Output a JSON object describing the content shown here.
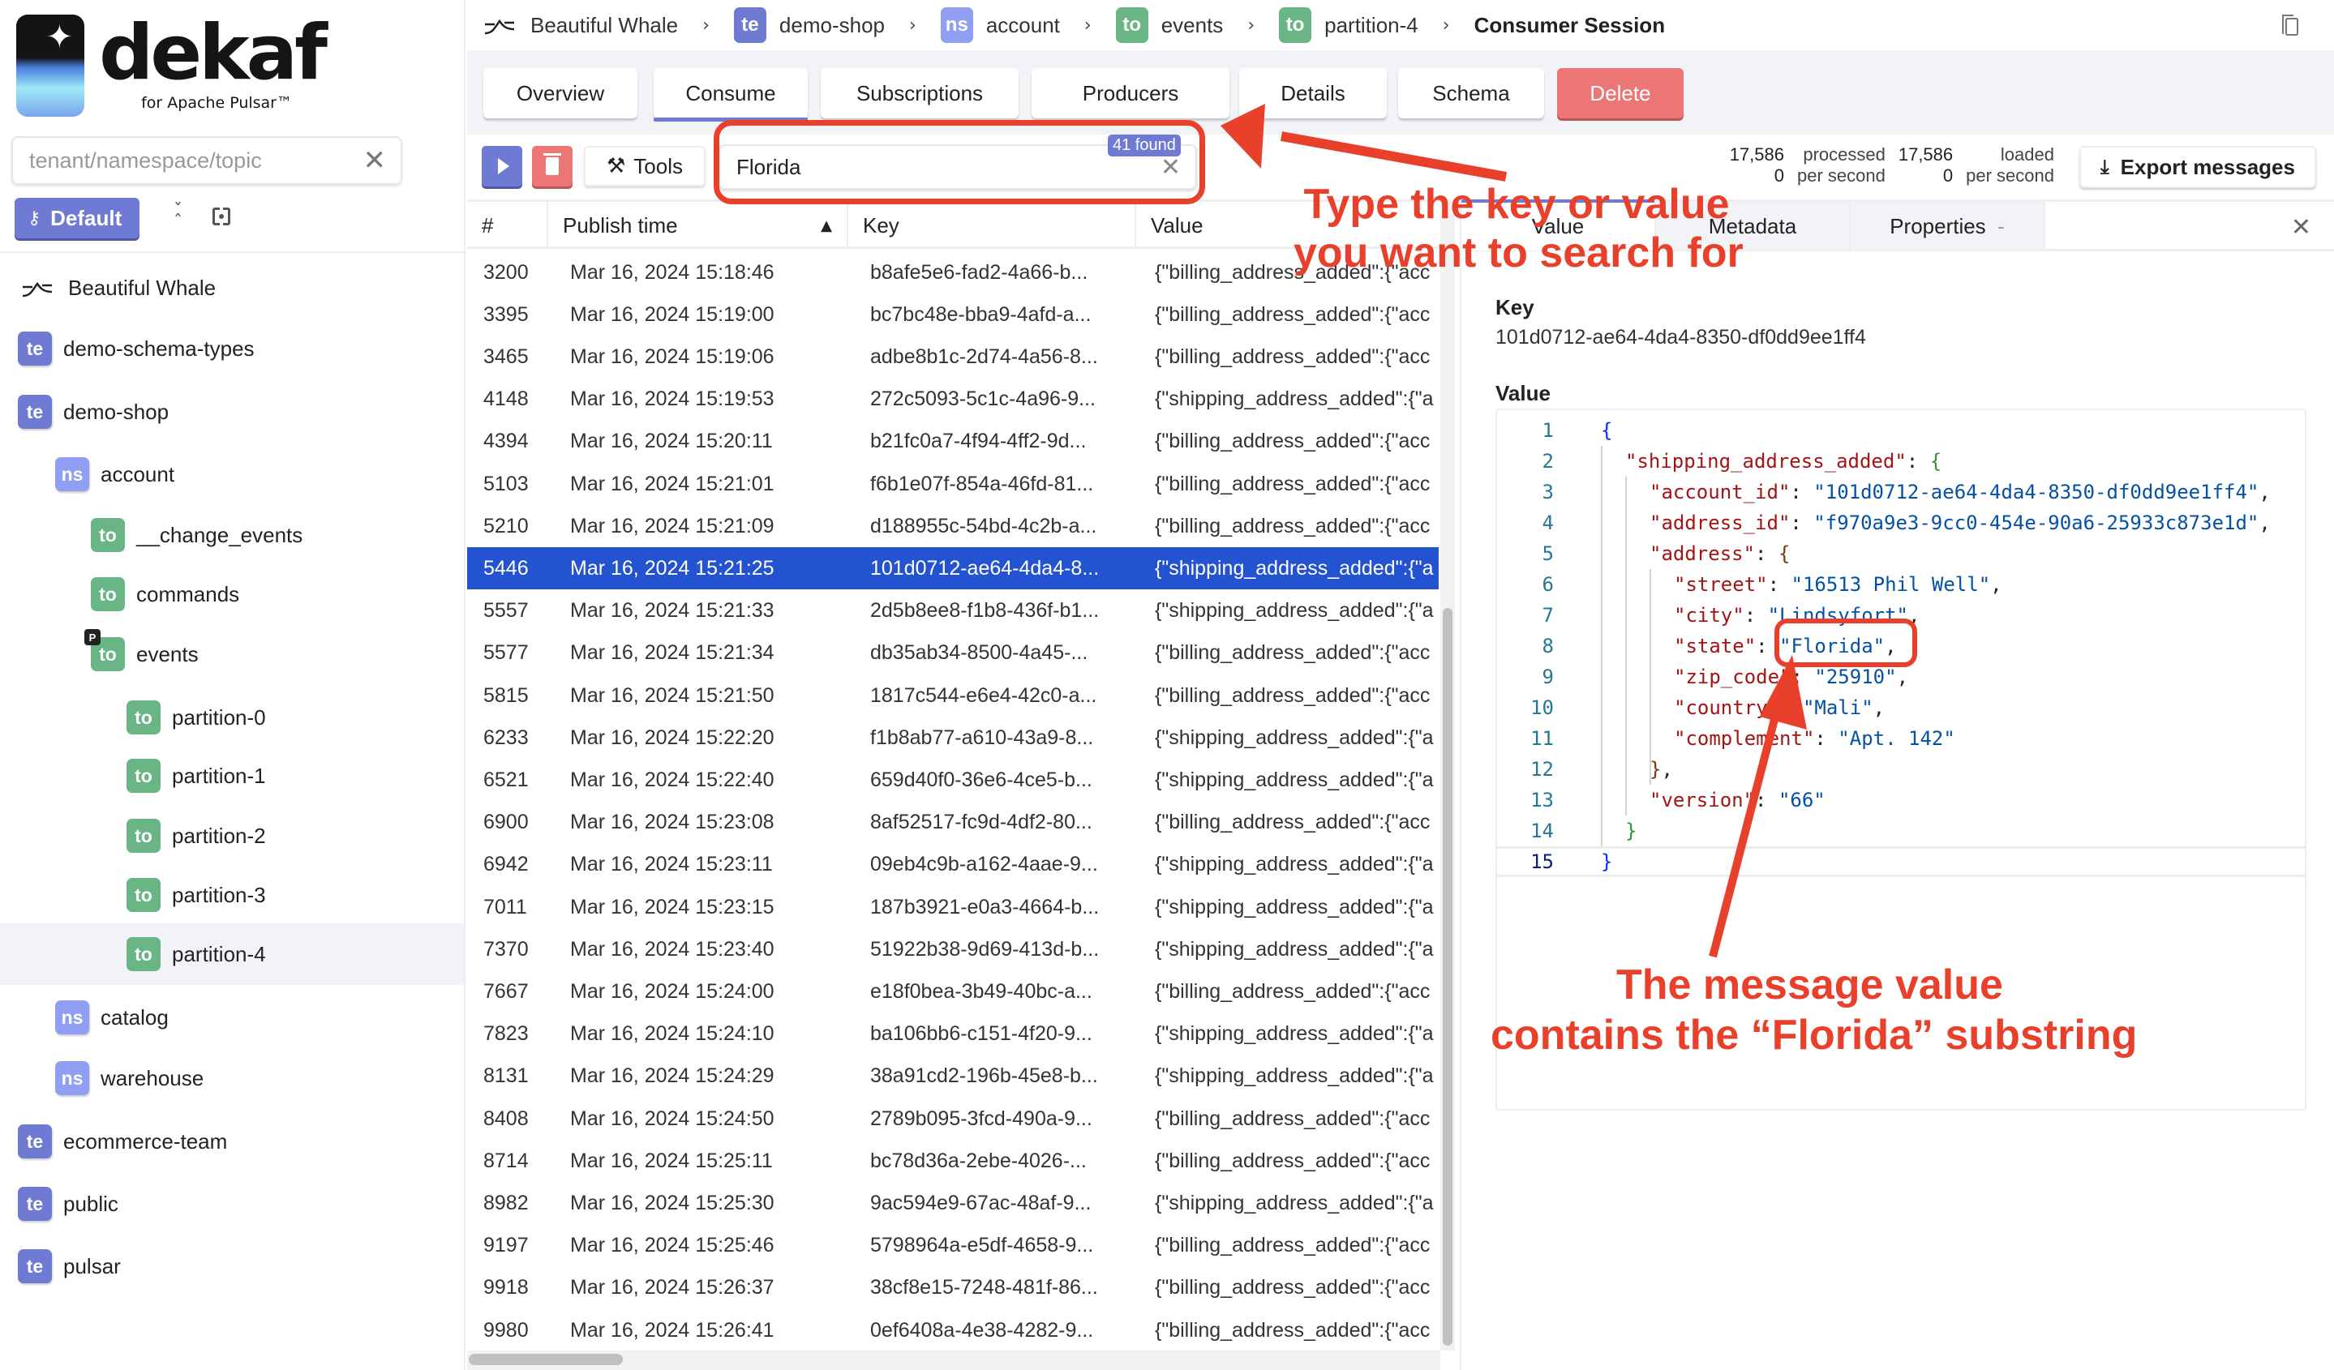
{
  "app": {
    "brand": "dekaf",
    "brand_sub": "for Apache Pulsar™"
  },
  "sidebar": {
    "search_placeholder": "tenant/namespace/topic",
    "search_value": "",
    "default_button": "Default",
    "tree": [
      {
        "type": "instance",
        "label": "Beautiful Whale",
        "level": 0
      },
      {
        "type": "te",
        "label": "demo-schema-types",
        "level": 0
      },
      {
        "type": "te",
        "label": "demo-shop",
        "level": 0
      },
      {
        "type": "ns",
        "label": "account",
        "level": 1
      },
      {
        "type": "to",
        "label": "__change_events",
        "level": 2
      },
      {
        "type": "to",
        "label": "commands",
        "level": 2
      },
      {
        "type": "to",
        "label": "events",
        "level": 2,
        "partitioned_marker": "P"
      },
      {
        "type": "to",
        "label": "partition-0",
        "level": 3
      },
      {
        "type": "to",
        "label": "partition-1",
        "level": 3
      },
      {
        "type": "to",
        "label": "partition-2",
        "level": 3
      },
      {
        "type": "to",
        "label": "partition-3",
        "level": 3
      },
      {
        "type": "to",
        "label": "partition-4",
        "level": 3,
        "active": true
      },
      {
        "type": "ns",
        "label": "catalog",
        "level": 1
      },
      {
        "type": "ns",
        "label": "warehouse",
        "level": 1
      },
      {
        "type": "te",
        "label": "ecommerce-team",
        "level": 0
      },
      {
        "type": "te",
        "label": "public",
        "level": 0
      },
      {
        "type": "te",
        "label": "pulsar",
        "level": 0
      }
    ]
  },
  "breadcrumb": {
    "items": [
      {
        "badge": "",
        "label": "Beautiful Whale"
      },
      {
        "badge": "te",
        "label": "demo-shop"
      },
      {
        "badge": "ns",
        "label": "account"
      },
      {
        "badge": "to",
        "label": "events"
      },
      {
        "badge": "to",
        "label": "partition-4"
      }
    ],
    "current": "Consumer Session"
  },
  "tabs": {
    "items": [
      "Overview",
      "Consume",
      "Subscriptions",
      "Producers",
      "Details",
      "Schema",
      "Delete"
    ],
    "active": "Consume"
  },
  "toolbar": {
    "tools_label": "Tools",
    "search_value": "Florida",
    "search_found": "41 found",
    "processed_count": "17,586",
    "processed_label": "processed",
    "processed_rate": "0",
    "processed_rate_label": "per second",
    "loaded_count": "17,586",
    "loaded_label": "loaded",
    "loaded_rate": "0",
    "loaded_rate_label": "per second",
    "export_label": "Export messages"
  },
  "table": {
    "columns": [
      "#",
      "Publish time",
      "Key",
      "Value"
    ],
    "sort_column": "Publish time",
    "sort_direction": "ascending",
    "rows": [
      {
        "num": "3200",
        "time": "Mar 16, 2024 15:18:46",
        "key": "b8afe5e6-fad2-4a66-b...",
        "value": "{\"billing_address_added\":{\"acc"
      },
      {
        "num": "3395",
        "time": "Mar 16, 2024 15:19:00",
        "key": "bc7bc48e-bba9-4afd-a...",
        "value": "{\"billing_address_added\":{\"acc"
      },
      {
        "num": "3465",
        "time": "Mar 16, 2024 15:19:06",
        "key": "adbe8b1c-2d74-4a56-8...",
        "value": "{\"billing_address_added\":{\"acc"
      },
      {
        "num": "4148",
        "time": "Mar 16, 2024 15:19:53",
        "key": "272c5093-5c1c-4a96-9...",
        "value": "{\"shipping_address_added\":{\"a"
      },
      {
        "num": "4394",
        "time": "Mar 16, 2024 15:20:11",
        "key": "b21fc0a7-4f94-4ff2-9d...",
        "value": "{\"billing_address_added\":{\"acc"
      },
      {
        "num": "5103",
        "time": "Mar 16, 2024 15:21:01",
        "key": "f6b1e07f-854a-46fd-81...",
        "value": "{\"billing_address_added\":{\"acc"
      },
      {
        "num": "5210",
        "time": "Mar 16, 2024 15:21:09",
        "key": "d188955c-54bd-4c2b-a...",
        "value": "{\"billing_address_added\":{\"acc"
      },
      {
        "num": "5446",
        "time": "Mar 16, 2024 15:21:25",
        "key": "101d0712-ae64-4da4-8...",
        "value": "{\"shipping_address_added\":{\"a",
        "selected": true
      },
      {
        "num": "5557",
        "time": "Mar 16, 2024 15:21:33",
        "key": "2d5b8ee8-f1b8-436f-b1...",
        "value": "{\"shipping_address_added\":{\"a"
      },
      {
        "num": "5577",
        "time": "Mar 16, 2024 15:21:34",
        "key": "db35ab34-8500-4a45-...",
        "value": "{\"billing_address_added\":{\"acc"
      },
      {
        "num": "5815",
        "time": "Mar 16, 2024 15:21:50",
        "key": "1817c544-e6e4-42c0-a...",
        "value": "{\"billing_address_added\":{\"acc"
      },
      {
        "num": "6233",
        "time": "Mar 16, 2024 15:22:20",
        "key": "f1b8ab77-a610-43a9-8...",
        "value": "{\"shipping_address_added\":{\"a"
      },
      {
        "num": "6521",
        "time": "Mar 16, 2024 15:22:40",
        "key": "659d40f0-36e6-4ce5-b...",
        "value": "{\"shipping_address_added\":{\"a"
      },
      {
        "num": "6900",
        "time": "Mar 16, 2024 15:23:08",
        "key": "8af52517-fc9d-4df2-80...",
        "value": "{\"billing_address_added\":{\"acc"
      },
      {
        "num": "6942",
        "time": "Mar 16, 2024 15:23:11",
        "key": "09eb4c9b-a162-4aae-9...",
        "value": "{\"shipping_address_added\":{\"a"
      },
      {
        "num": "7011",
        "time": "Mar 16, 2024 15:23:15",
        "key": "187b3921-e0a3-4664-b...",
        "value": "{\"shipping_address_added\":{\"a"
      },
      {
        "num": "7370",
        "time": "Mar 16, 2024 15:23:40",
        "key": "51922b38-9d69-413d-b...",
        "value": "{\"shipping_address_added\":{\"a"
      },
      {
        "num": "7667",
        "time": "Mar 16, 2024 15:24:00",
        "key": "e18f0bea-3b49-40bc-a...",
        "value": "{\"billing_address_added\":{\"acc"
      },
      {
        "num": "7823",
        "time": "Mar 16, 2024 15:24:10",
        "key": "ba106bb6-c151-4f20-9...",
        "value": "{\"shipping_address_added\":{\"a"
      },
      {
        "num": "8131",
        "time": "Mar 16, 2024 15:24:29",
        "key": "38a91cd2-196b-45e8-b...",
        "value": "{\"shipping_address_added\":{\"a"
      },
      {
        "num": "8408",
        "time": "Mar 16, 2024 15:24:50",
        "key": "2789b095-3fcd-490a-9...",
        "value": "{\"billing_address_added\":{\"acc"
      },
      {
        "num": "8714",
        "time": "Mar 16, 2024 15:25:11",
        "key": "bc78d36a-2ebe-4026-...",
        "value": "{\"billing_address_added\":{\"acc"
      },
      {
        "num": "8982",
        "time": "Mar 16, 2024 15:25:30",
        "key": "9ac594e9-67ac-48af-9...",
        "value": "{\"shipping_address_added\":{\"a"
      },
      {
        "num": "9197",
        "time": "Mar 16, 2024 15:25:46",
        "key": "5798964a-e5df-4658-9...",
        "value": "{\"billing_address_added\":{\"acc"
      },
      {
        "num": "9918",
        "time": "Mar 16, 2024 15:26:37",
        "key": "38cf8e15-7248-481f-86...",
        "value": "{\"billing_address_added\":{\"acc"
      },
      {
        "num": "9980",
        "time": "Mar 16, 2024 15:26:41",
        "key": "0ef6408a-4e38-4282-9...",
        "value": "{\"billing_address_added\":{\"acc"
      }
    ]
  },
  "detail": {
    "tabs": [
      "Value",
      "Metadata",
      "Properties"
    ],
    "properties_suffix": "-",
    "active_tab": "Value",
    "key_label": "Key",
    "key_value": "101d0712-ae64-4da4-8350-df0dd9ee1ff4",
    "value_label": "Value",
    "code_lines": [
      {
        "n": "1",
        "indent": 0,
        "tokens": [
          [
            "b1",
            "{"
          ]
        ]
      },
      {
        "n": "2",
        "indent": 1,
        "tokens": [
          [
            "key",
            "\"shipping_address_added\""
          ],
          [
            "punc",
            ": "
          ],
          [
            "b2",
            "{"
          ]
        ]
      },
      {
        "n": "3",
        "indent": 2,
        "tokens": [
          [
            "key",
            "\"account_id\""
          ],
          [
            "punc",
            ": "
          ],
          [
            "str",
            "\"101d0712-ae64-4da4-8350-df0dd9ee1ff4\""
          ],
          [
            "punc",
            ","
          ]
        ]
      },
      {
        "n": "4",
        "indent": 2,
        "tokens": [
          [
            "key",
            "\"address_id\""
          ],
          [
            "punc",
            ": "
          ],
          [
            "str",
            "\"f970a9e3-9cc0-454e-90a6-25933c873e1d\""
          ],
          [
            "punc",
            ","
          ]
        ]
      },
      {
        "n": "5",
        "indent": 2,
        "tokens": [
          [
            "key",
            "\"address\""
          ],
          [
            "punc",
            ": "
          ],
          [
            "b3",
            "{"
          ]
        ]
      },
      {
        "n": "6",
        "indent": 3,
        "tokens": [
          [
            "key",
            "\"street\""
          ],
          [
            "punc",
            ": "
          ],
          [
            "str",
            "\"16513 Phil Well\""
          ],
          [
            "punc",
            ","
          ]
        ]
      },
      {
        "n": "7",
        "indent": 3,
        "tokens": [
          [
            "key",
            "\"city\""
          ],
          [
            "punc",
            ": "
          ],
          [
            "str",
            "\"Lindsyfort\""
          ],
          [
            "punc",
            ","
          ]
        ]
      },
      {
        "n": "8",
        "indent": 3,
        "tokens": [
          [
            "key",
            "\"state\""
          ],
          [
            "punc",
            ": "
          ],
          [
            "str",
            "\"Florida\""
          ],
          [
            "punc",
            ","
          ]
        ]
      },
      {
        "n": "9",
        "indent": 3,
        "tokens": [
          [
            "key",
            "\"zip_code\""
          ],
          [
            "punc",
            ": "
          ],
          [
            "str",
            "\"25910\""
          ],
          [
            "punc",
            ","
          ]
        ]
      },
      {
        "n": "10",
        "indent": 3,
        "tokens": [
          [
            "key",
            "\"country\""
          ],
          [
            "punc",
            ": "
          ],
          [
            "str",
            "\"Mali\""
          ],
          [
            "punc",
            ","
          ]
        ]
      },
      {
        "n": "11",
        "indent": 3,
        "tokens": [
          [
            "key",
            "\"complement\""
          ],
          [
            "punc",
            ": "
          ],
          [
            "str",
            "\"Apt. 142\""
          ]
        ]
      },
      {
        "n": "12",
        "indent": 2,
        "tokens": [
          [
            "b3",
            "}"
          ],
          [
            "punc",
            ","
          ]
        ]
      },
      {
        "n": "13",
        "indent": 2,
        "tokens": [
          [
            "key",
            "\"version\""
          ],
          [
            "punc",
            ": "
          ],
          [
            "str",
            "\"66\""
          ]
        ]
      },
      {
        "n": "14",
        "indent": 1,
        "tokens": [
          [
            "b2",
            "}"
          ]
        ]
      },
      {
        "n": "15",
        "indent": 0,
        "tokens": [
          [
            "b1",
            "}"
          ]
        ],
        "current": true
      }
    ]
  },
  "annotations": {
    "search_hint_line1": "Type the key or value",
    "search_hint_line2": "you want to search for",
    "value_hint_line1": "The message value",
    "value_hint_line2": "contains the “Florida” substring",
    "color": "#e8402a"
  },
  "colors": {
    "tenant_badge": "#6f7bd2",
    "namespace_badge": "#909ff3",
    "topic_badge": "#69b585",
    "selected_row": "#2453d1",
    "delete": "#ec7676",
    "accent": "#6f7bd2"
  }
}
